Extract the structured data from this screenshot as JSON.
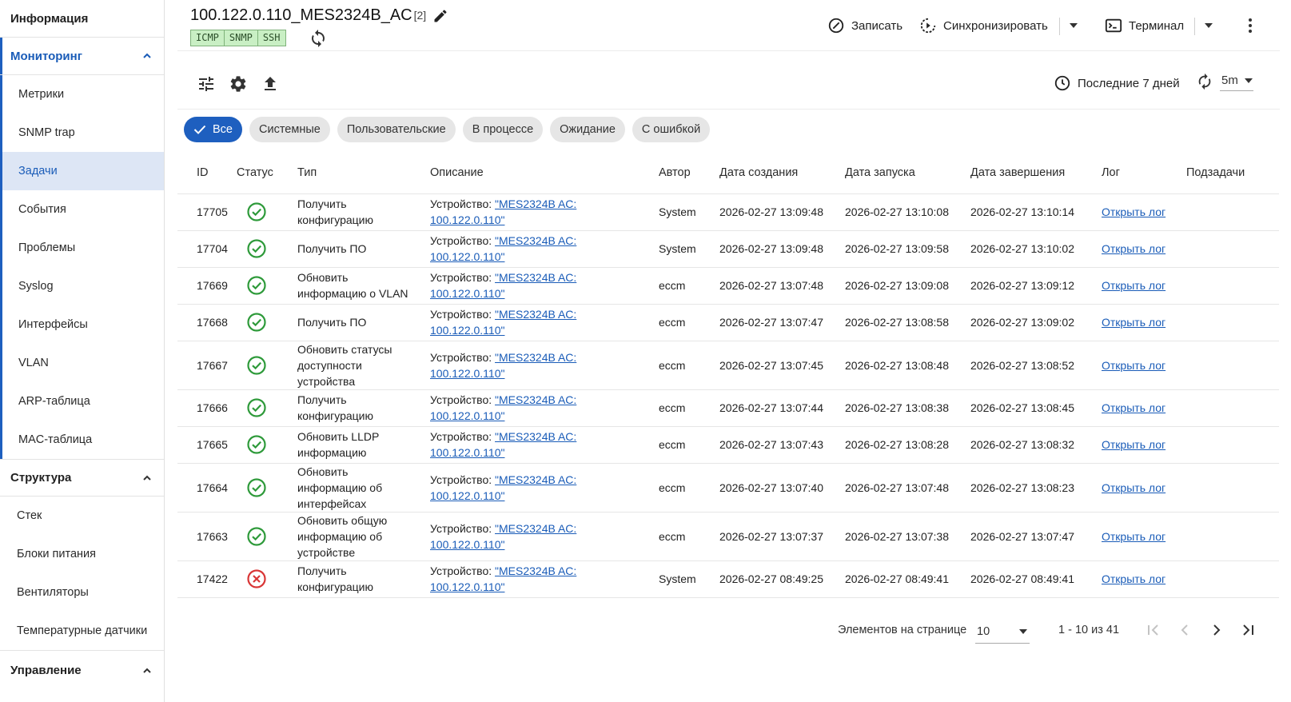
{
  "sidebar": {
    "info": "Информация",
    "monitoring": {
      "title": "Мониторинг",
      "items": [
        "Метрики",
        "SNMP trap",
        "Задачи",
        "События",
        "Проблемы",
        "Syslog",
        "Интерфейсы",
        "VLAN",
        "ARP-таблица",
        "MAC-таблица"
      ],
      "selected": "Задачи"
    },
    "structure": {
      "title": "Структура",
      "items": [
        "Стек",
        "Блоки питания",
        "Вентиляторы",
        "Температурные датчики"
      ]
    },
    "management": {
      "title": "Управление"
    }
  },
  "header": {
    "title": "100.122.0.110_MES2324B_AC",
    "title_count": "[2]",
    "badges": [
      "ICMP",
      "SNMP",
      "SSH"
    ],
    "actions": {
      "record": "Записать",
      "sync": "Синхронизировать",
      "terminal": "Терминал"
    }
  },
  "toolbar": {
    "period": "Последние 7 дней",
    "interval": "5m"
  },
  "chips": [
    "Все",
    "Системные",
    "Пользовательские",
    "В процессе",
    "Ожидание",
    "С ошибкой"
  ],
  "table": {
    "columns": [
      "ID",
      "Статус",
      "Тип",
      "Описание",
      "Автор",
      "Дата создания",
      "Дата запуска",
      "Дата завершения",
      "Лог",
      "Подзадачи"
    ],
    "desc_prefix": "Устройство: ",
    "rows": [
      {
        "id": "17705",
        "status": "ok",
        "type": "Получить конфигурацию",
        "device": "\"MES2324B AC: 100.122.0.110\"",
        "author": "System",
        "created": "2026-02-27 13:09:48",
        "started": "2026-02-27 13:10:08",
        "finished": "2026-02-27 13:10:14",
        "log": "Открыть лог"
      },
      {
        "id": "17704",
        "status": "ok",
        "type": "Получить ПО",
        "device": "\"MES2324B AC: 100.122.0.110\"",
        "author": "System",
        "created": "2026-02-27 13:09:48",
        "started": "2026-02-27 13:09:58",
        "finished": "2026-02-27 13:10:02",
        "log": "Открыть лог"
      },
      {
        "id": "17669",
        "status": "ok",
        "type": "Обновить информацию о VLAN",
        "device": "\"MES2324B AC: 100.122.0.110\"",
        "author": "eccm",
        "created": "2026-02-27 13:07:48",
        "started": "2026-02-27 13:09:08",
        "finished": "2026-02-27 13:09:12",
        "log": "Открыть лог"
      },
      {
        "id": "17668",
        "status": "ok",
        "type": "Получить ПО",
        "device": "\"MES2324B AC: 100.122.0.110\"",
        "author": "eccm",
        "created": "2026-02-27 13:07:47",
        "started": "2026-02-27 13:08:58",
        "finished": "2026-02-27 13:09:02",
        "log": "Открыть лог"
      },
      {
        "id": "17667",
        "status": "ok",
        "type": "Обновить статусы доступности устройства",
        "device": "\"MES2324B AC: 100.122.0.110\"",
        "author": "eccm",
        "created": "2026-02-27 13:07:45",
        "started": "2026-02-27 13:08:48",
        "finished": "2026-02-27 13:08:52",
        "log": "Открыть лог"
      },
      {
        "id": "17666",
        "status": "ok",
        "type": "Получить конфигурацию",
        "device": "\"MES2324B AC: 100.122.0.110\"",
        "author": "eccm",
        "created": "2026-02-27 13:07:44",
        "started": "2026-02-27 13:08:38",
        "finished": "2026-02-27 13:08:45",
        "log": "Открыть лог"
      },
      {
        "id": "17665",
        "status": "ok",
        "type": "Обновить LLDP информацию",
        "device": "\"MES2324B AC: 100.122.0.110\"",
        "author": "eccm",
        "created": "2026-02-27 13:07:43",
        "started": "2026-02-27 13:08:28",
        "finished": "2026-02-27 13:08:32",
        "log": "Открыть лог"
      },
      {
        "id": "17664",
        "status": "ok",
        "type": "Обновить информацию об интерфейсах",
        "device": "\"MES2324B AC: 100.122.0.110\"",
        "author": "eccm",
        "created": "2026-02-27 13:07:40",
        "started": "2026-02-27 13:07:48",
        "finished": "2026-02-27 13:08:23",
        "log": "Открыть лог"
      },
      {
        "id": "17663",
        "status": "ok",
        "type": "Обновить общую информацию об устройстве",
        "device": "\"MES2324B AC: 100.122.0.110\"",
        "author": "eccm",
        "created": "2026-02-27 13:07:37",
        "started": "2026-02-27 13:07:38",
        "finished": "2026-02-27 13:07:47",
        "log": "Открыть лог"
      },
      {
        "id": "17422",
        "status": "error",
        "type": "Получить конфигурацию",
        "device": "\"MES2324B AC: 100.122.0.110\"",
        "author": "System",
        "created": "2026-02-27 08:49:25",
        "started": "2026-02-27 08:49:41",
        "finished": "2026-02-27 08:49:41",
        "log": "Открыть лог"
      }
    ]
  },
  "pagination": {
    "label": "Элементов на странице",
    "page_size": "10",
    "range": "1 - 10 из 41"
  },
  "colors": {
    "accent": "#1e5fbf",
    "ok": "#2e9a3a",
    "error": "#d93636",
    "badge_bg": "#c9efc4"
  }
}
